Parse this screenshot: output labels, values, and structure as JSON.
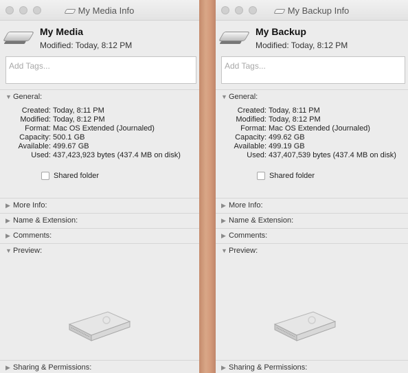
{
  "panels": [
    {
      "window_title": "My Media Info",
      "name": "My Media",
      "modified": "Modified: Today, 8:12 PM",
      "tags_placeholder": "Add Tags...",
      "sections": {
        "general": "General:",
        "more_info": "More Info:",
        "name_ext": "Name & Extension:",
        "comments": "Comments:",
        "preview": "Preview:",
        "sharing": "Sharing & Permissions:"
      },
      "general": {
        "created_label": "Created:",
        "created": "Today, 8:11 PM",
        "modified_label": "Modified:",
        "modified": "Today, 8:12 PM",
        "format_label": "Format:",
        "format": "Mac OS Extended (Journaled)",
        "capacity_label": "Capacity:",
        "capacity": "500.1 GB",
        "available_label": "Available:",
        "available": "499.67 GB",
        "used_label": "Used:",
        "used": "437,423,923 bytes (437.4 MB on disk)",
        "shared_folder": "Shared folder"
      }
    },
    {
      "window_title": "My Backup Info",
      "name": "My Backup",
      "modified": "Modified: Today, 8:12 PM",
      "tags_placeholder": "Add Tags...",
      "sections": {
        "general": "General:",
        "more_info": "More Info:",
        "name_ext": "Name & Extension:",
        "comments": "Comments:",
        "preview": "Preview:",
        "sharing": "Sharing & Permissions:"
      },
      "general": {
        "created_label": "Created:",
        "created": "Today, 8:11 PM",
        "modified_label": "Modified:",
        "modified": "Today, 8:12 PM",
        "format_label": "Format:",
        "format": "Mac OS Extended (Journaled)",
        "capacity_label": "Capacity:",
        "capacity": "499.62 GB",
        "available_label": "Available:",
        "available": "499.19 GB",
        "used_label": "Used:",
        "used": "437,407,539 bytes (437.4 MB on disk)",
        "shared_folder": "Shared folder"
      }
    }
  ],
  "icons": {
    "expanded": "disclosure-triangle-down-icon",
    "collapsed": "disclosure-triangle-right-icon",
    "disk": "external-drive-icon"
  },
  "colors": {
    "window_bg": "#ececec",
    "divider": "#d3997a"
  }
}
